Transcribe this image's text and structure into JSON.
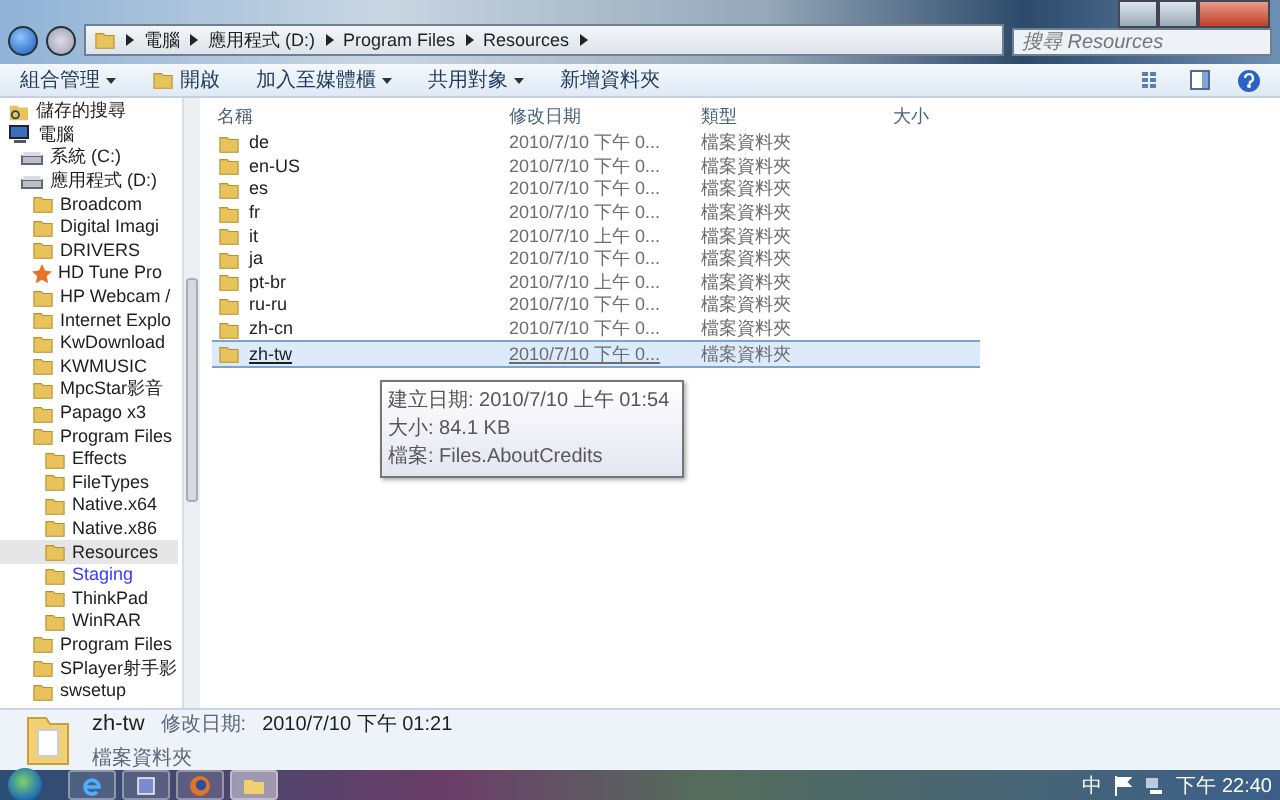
{
  "address_bar": {
    "crumbs": [
      "電腦",
      "應用程式 (D:)",
      "Program Files",
      "Resources"
    ]
  },
  "search": {
    "placeholder": "搜尋 Resources"
  },
  "toolbar": {
    "buttons": [
      {
        "label": "組合管理",
        "dropdown": true,
        "kind": "text"
      },
      {
        "label": "開啟",
        "dropdown": false,
        "kind": "open"
      },
      {
        "label": "加入至媒體櫃",
        "dropdown": true,
        "kind": "text"
      },
      {
        "label": "共用對象",
        "dropdown": true,
        "kind": "text"
      },
      {
        "label": "新增資料夾",
        "dropdown": false,
        "kind": "text"
      }
    ]
  },
  "sidebar": {
    "items": [
      {
        "label": "儲存的搜尋",
        "kind": "search",
        "selected": false,
        "hovered": false
      },
      {
        "label": "電腦",
        "kind": "computer",
        "selected": false,
        "hovered": false,
        "children": [
          {
            "label": "系統 (C:)",
            "kind": "drive",
            "selected": false,
            "hovered": false
          },
          {
            "label": "應用程式 (D:)",
            "kind": "drive",
            "selected": false,
            "hovered": false,
            "children": [
              {
                "label": "Broadcom",
                "kind": "folder",
                "selected": false,
                "hovered": false
              },
              {
                "label": "Digital Imagi",
                "kind": "folder",
                "selected": false,
                "hovered": false
              },
              {
                "label": "DRIVERS",
                "kind": "folder",
                "selected": false,
                "hovered": false
              },
              {
                "label": "HD Tune Pro",
                "kind": "star",
                "selected": false,
                "hovered": false
              },
              {
                "label": "HP Webcam /",
                "kind": "folder",
                "selected": false,
                "hovered": false
              },
              {
                "label": "Internet Explo",
                "kind": "folder",
                "selected": false,
                "hovered": false
              },
              {
                "label": "KwDownload",
                "kind": "folder",
                "selected": false,
                "hovered": false
              },
              {
                "label": "KWMUSIC",
                "kind": "folder",
                "selected": false,
                "hovered": false
              },
              {
                "label": "MpcStar影音",
                "kind": "folder",
                "selected": false,
                "hovered": false
              },
              {
                "label": "Papago x3",
                "kind": "folder",
                "selected": false,
                "hovered": false
              },
              {
                "label": "Program Files",
                "kind": "folder",
                "selected": false,
                "hovered": false,
                "children": [
                  {
                    "label": "Effects",
                    "kind": "folder",
                    "selected": false,
                    "hovered": false
                  },
                  {
                    "label": "FileTypes",
                    "kind": "folder",
                    "selected": false,
                    "hovered": false
                  },
                  {
                    "label": "Native.x64",
                    "kind": "folder",
                    "selected": false,
                    "hovered": false
                  },
                  {
                    "label": "Native.x86",
                    "kind": "folder",
                    "selected": false,
                    "hovered": false
                  },
                  {
                    "label": "Resources",
                    "kind": "folder",
                    "selected": true,
                    "hovered": false
                  },
                  {
                    "label": "Staging",
                    "kind": "folder",
                    "selected": false,
                    "hovered": true
                  },
                  {
                    "label": "ThinkPad",
                    "kind": "folder",
                    "selected": false,
                    "hovered": false
                  },
                  {
                    "label": "WinRAR",
                    "kind": "folder",
                    "selected": false,
                    "hovered": false
                  }
                ]
              },
              {
                "label": "Program Files",
                "kind": "folder",
                "selected": false,
                "hovered": false
              },
              {
                "label": "SPlayer射手影",
                "kind": "folder",
                "selected": false,
                "hovered": false
              },
              {
                "label": "swsetup",
                "kind": "folder",
                "selected": false,
                "hovered": false
              }
            ]
          }
        ]
      }
    ]
  },
  "table": {
    "columns": [
      "名稱",
      "修改日期",
      "類型",
      "大小"
    ],
    "rows": [
      {
        "name": "de",
        "date": "2010/7/10 下午 0...",
        "type": "檔案資料夾",
        "selected": false
      },
      {
        "name": "en-US",
        "date": "2010/7/10 下午 0...",
        "type": "檔案資料夾",
        "selected": false
      },
      {
        "name": "es",
        "date": "2010/7/10 下午 0...",
        "type": "檔案資料夾",
        "selected": false
      },
      {
        "name": "fr",
        "date": "2010/7/10 下午 0...",
        "type": "檔案資料夾",
        "selected": false
      },
      {
        "name": "it",
        "date": "2010/7/10 上午 0...",
        "type": "檔案資料夾",
        "selected": false
      },
      {
        "name": "ja",
        "date": "2010/7/10 下午 0...",
        "type": "檔案資料夾",
        "selected": false
      },
      {
        "name": "pt-br",
        "date": "2010/7/10 上午 0...",
        "type": "檔案資料夾",
        "selected": false
      },
      {
        "name": "ru-ru",
        "date": "2010/7/10 下午 0...",
        "type": "檔案資料夾",
        "selected": false
      },
      {
        "name": "zh-cn",
        "date": "2010/7/10 下午 0...",
        "type": "檔案資料夾",
        "selected": false
      },
      {
        "name": "zh-tw",
        "date": "2010/7/10 下午 0...",
        "type": "檔案資料夾",
        "selected": true
      }
    ]
  },
  "tooltip": {
    "lines": [
      "建立日期: 2010/7/10 上午 01:54",
      "大小: 84.1 KB",
      "檔案: Files.AboutCredits"
    ]
  },
  "details_pane": {
    "name": "zh-tw",
    "modified_label": "修改日期:",
    "modified": "2010/7/10 下午 01:21",
    "type": "檔案資料夾"
  },
  "taskbar": {
    "apps": [
      {
        "kind": "ie",
        "selected": false
      },
      {
        "kind": "app",
        "selected": false
      },
      {
        "kind": "firefox",
        "selected": false
      },
      {
        "kind": "explorer",
        "selected": true
      }
    ],
    "ime": "中",
    "clock": "下午 22:40"
  }
}
